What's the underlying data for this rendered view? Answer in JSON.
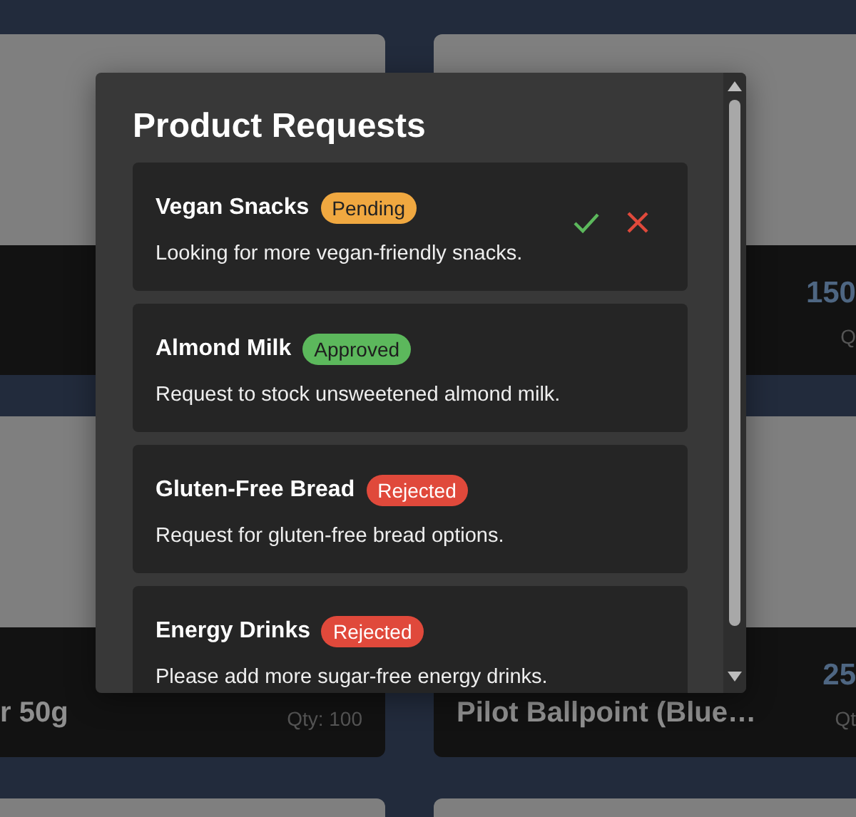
{
  "background": {
    "cards": [
      {
        "kind": "product"
      },
      {
        "kind": "product",
        "price": "150",
        "qty": "Q"
      },
      {
        "kind": "product",
        "name": "r 50g",
        "qty": "Qty: 100"
      },
      {
        "kind": "product",
        "name": "Pilot Ballpoint (Blue…",
        "price": "25",
        "qty": "Qt"
      },
      {
        "kind": "image_only"
      },
      {
        "kind": "image_only"
      }
    ]
  },
  "modal": {
    "title": "Product Requests",
    "requests": [
      {
        "title": "Vegan Snacks",
        "status": {
          "label": "Pending",
          "kind": "pending"
        },
        "description": "Looking for more vegan-friendly snacks.",
        "actions": true
      },
      {
        "title": "Almond Milk",
        "status": {
          "label": "Approved",
          "kind": "approved"
        },
        "description": "Request to stock unsweetened almond milk.",
        "actions": false
      },
      {
        "title": "Gluten-Free Bread",
        "status": {
          "label": "Rejected",
          "kind": "rejected"
        },
        "description": "Request for gluten-free bread options.",
        "actions": false
      },
      {
        "title": "Energy Drinks",
        "status": {
          "label": "Rejected",
          "kind": "rejected"
        },
        "description": "Please add more sugar-free energy drinks.",
        "actions": false
      }
    ]
  }
}
